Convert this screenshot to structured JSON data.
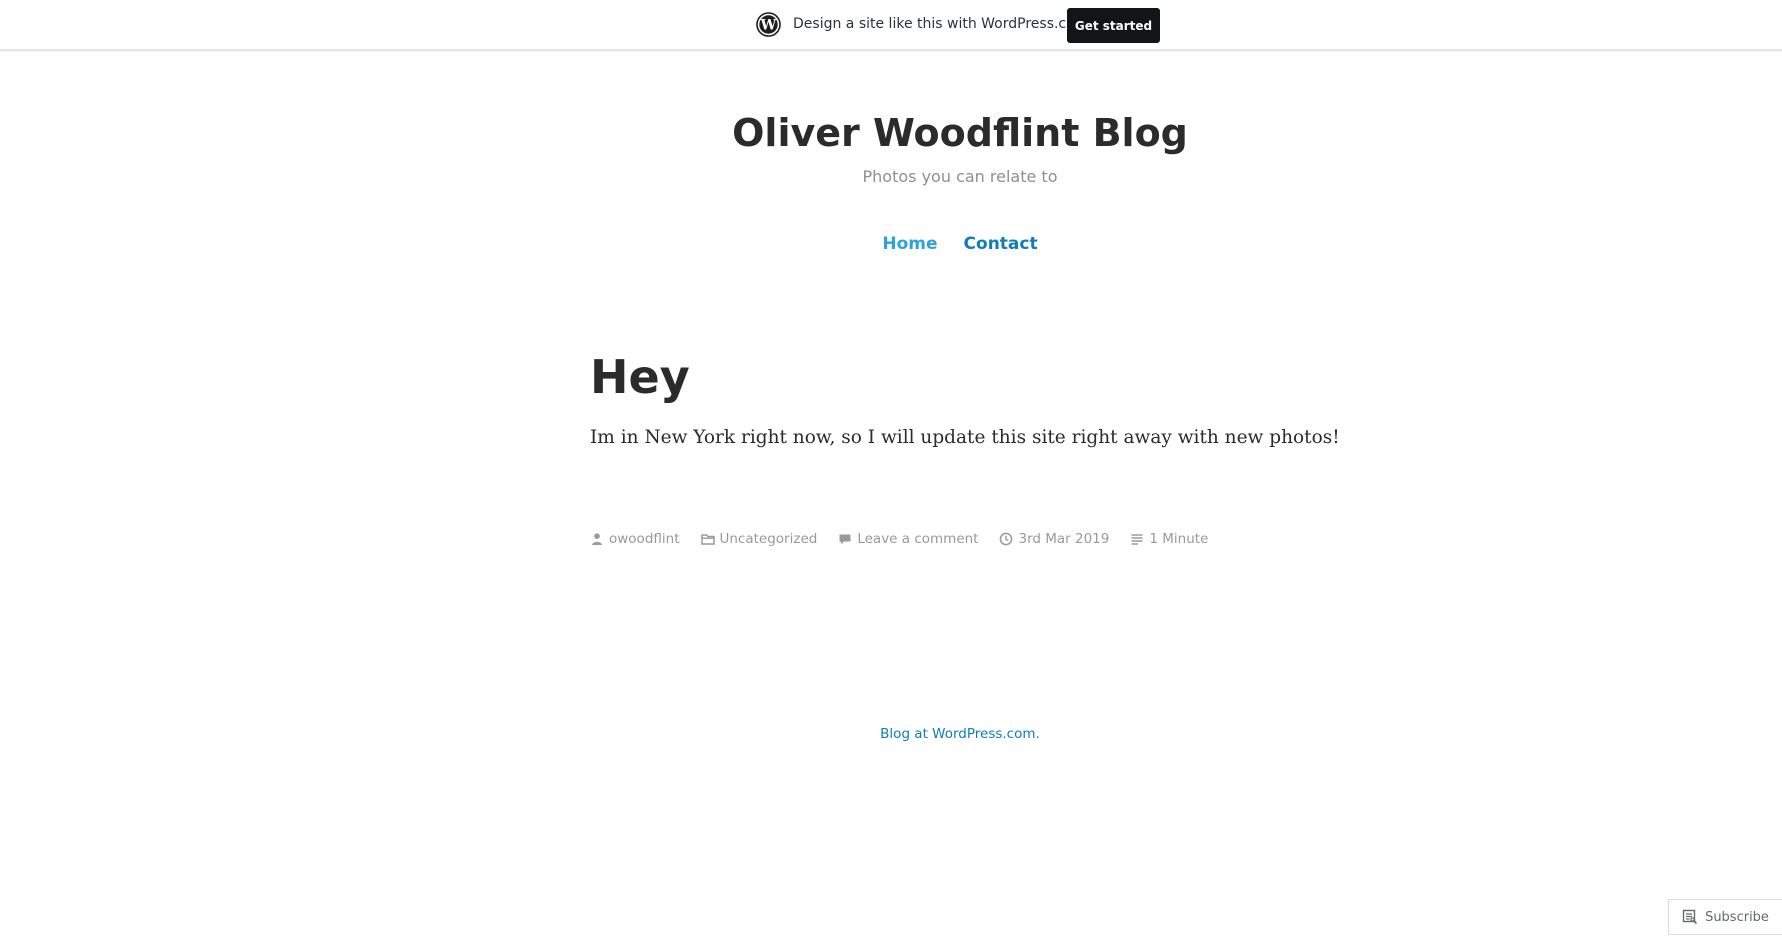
{
  "banner": {
    "text": "Design a site like this with WordPress.com",
    "cta_label": "Get started",
    "logo_icon": "wordpress-logo-icon"
  },
  "header": {
    "site_title": "Oliver Woodflint Blog",
    "site_description": "Photos you can relate to"
  },
  "nav": {
    "items": [
      {
        "label": "Home"
      },
      {
        "label": "Contact"
      }
    ]
  },
  "post": {
    "title": "Hey",
    "body": "Im in New York right now, so I will update this site right away with new photos!",
    "meta": {
      "author": "owoodflint",
      "category": "Uncategorized",
      "comments": "Leave a comment",
      "date": "3rd Mar 2019",
      "reading_time": "1 Minute"
    }
  },
  "footer": {
    "credit": "Blog at WordPress.com."
  },
  "subscribe": {
    "label": "Subscribe"
  },
  "colors": {
    "link_home": "#2ea3d8",
    "link": "#0f7eb8",
    "meta_text": "#9a9a9a",
    "title_text": "#2b2b2b",
    "cta_bg": "#101517"
  }
}
